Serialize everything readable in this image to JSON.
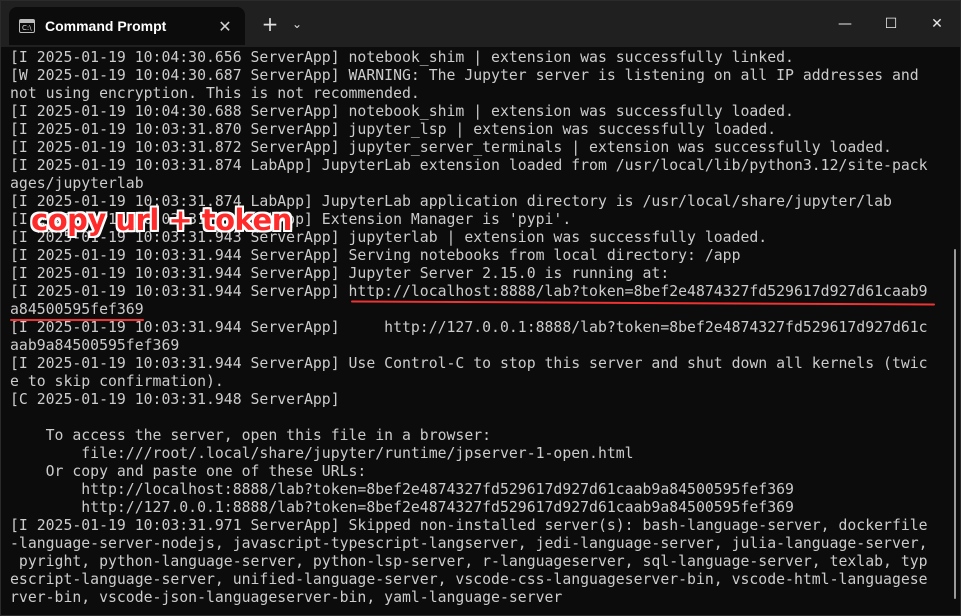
{
  "titlebar": {
    "tab_title": "Command Prompt",
    "tab_icon_text": "C:\\",
    "close_tab": "✕",
    "new_tab": "+",
    "dropdown": "⌄",
    "minimize": "—",
    "maximize": "☐",
    "close": "✕"
  },
  "annotation": {
    "text": "copy url + token",
    "color": "#ff2b2b"
  },
  "terminal": {
    "lines": [
      "[I 2025-01-19 10:04:30.656 ServerApp] notebook_shim | extension was successfully linked.",
      "[W 2025-01-19 10:04:30.687 ServerApp] WARNING: The Jupyter server is listening on all IP addresses and",
      "not using encryption. This is not recommended.",
      "[I 2025-01-19 10:04:30.688 ServerApp] notebook_shim | extension was successfully loaded.",
      "[I 2025-01-19 10:03:31.870 ServerApp] jupyter_lsp | extension was successfully loaded.",
      "[I 2025-01-19 10:03:31.872 ServerApp] jupyter_server_terminals | extension was successfully loaded.",
      "[I 2025-01-19 10:03:31.874 LabApp] JupyterLab extension loaded from /usr/local/lib/python3.12/site-pack",
      "ages/jupyterlab",
      "[I 2025-01-19 10:03:31.874 LabApp] JupyterLab application directory is /usr/local/share/jupyter/lab",
      "[I 2025-01-19 10:03:31.874 LabApp] Extension Manager is 'pypi'.",
      "[I 2025-01-19 10:03:31.943 ServerApp] jupyterlab | extension was successfully loaded.",
      "[I 2025-01-19 10:03:31.944 ServerApp] Serving notebooks from local directory: /app",
      "[I 2025-01-19 10:03:31.944 ServerApp] Jupyter Server 2.15.0 is running at:",
      "[I 2025-01-19 10:03:31.944 ServerApp] http://localhost:8888/lab?token=8bef2e4874327fd529617d927d61caab9",
      "a84500595fef369",
      "[I 2025-01-19 10:03:31.944 ServerApp]     http://127.0.0.1:8888/lab?token=8bef2e4874327fd529617d927d61c",
      "aab9a84500595fef369",
      "[I 2025-01-19 10:03:31.944 ServerApp] Use Control-C to stop this server and shut down all kernels (twic",
      "e to skip confirmation).",
      "[C 2025-01-19 10:03:31.948 ServerApp]",
      "",
      "    To access the server, open this file in a browser:",
      "        file:///root/.local/share/jupyter/runtime/jpserver-1-open.html",
      "    Or copy and paste one of these URLs:",
      "        http://localhost:8888/lab?token=8bef2e4874327fd529617d927d61caab9a84500595fef369",
      "        http://127.0.0.1:8888/lab?token=8bef2e4874327fd529617d927d61caab9a84500595fef369",
      "[I 2025-01-19 10:03:31.971 ServerApp] Skipped non-installed server(s): bash-language-server, dockerfile",
      "-language-server-nodejs, javascript-typescript-langserver, jedi-language-server, julia-language-server,",
      " pyright, python-language-server, python-lsp-server, r-languageserver, sql-language-server, texlab, typ",
      "escript-language-server, unified-language-server, vscode-css-languageserver-bin, vscode-html-languagese",
      "rver-bin, vscode-json-languageserver-bin, yaml-language-server"
    ]
  }
}
